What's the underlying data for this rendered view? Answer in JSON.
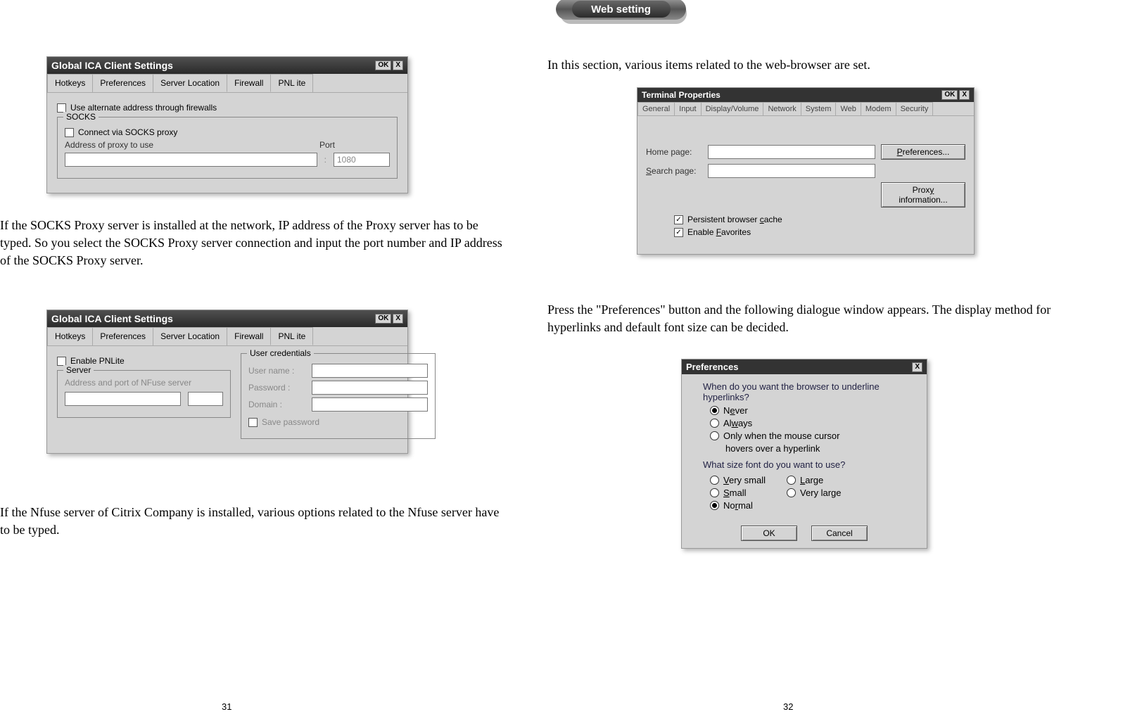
{
  "left": {
    "ica": {
      "title": "Global ICA Client Settings",
      "ok": "OK",
      "close": "X",
      "tabs": [
        "Hotkeys",
        "Preferences",
        "Server Location",
        "Firewall",
        "PNL ite"
      ],
      "firewall": {
        "alt_addr": "Use alternate address through firewalls",
        "socks_legend": "SOCKS",
        "connect_via": "Connect via SOCKS proxy",
        "proxy_label": "Address of proxy to use",
        "port_label": "Port",
        "port_value": "1080"
      },
      "pnlite": {
        "enable": "Enable PNLite",
        "server_legend": "Server",
        "server_label": "Address and port of NFuse server",
        "uc_legend": "User credentials",
        "user_label": "User name :",
        "pass_label": "Password :",
        "domain_label": "Domain :",
        "save_pw": "Save password"
      }
    },
    "para1": "If the SOCKS Proxy server is installed at the network, IP address of the Proxy server has to be typed. So you select the SOCKS Proxy server connection and input the port number and IP address of the SOCKS Proxy server.",
    "para2": "If the Nfuse server of Citrix Company is installed, various options related to the Nfuse server have to be typed.",
    "pagenum": "31"
  },
  "right": {
    "header": "Web setting",
    "para1": "In this section, various items related to the web-browser are set.",
    "term": {
      "title": "Terminal Properties",
      "ok": "OK",
      "close": "X",
      "tabs": [
        "General",
        "Input",
        "Display/Volume",
        "Network",
        "System",
        "Web",
        "Modem",
        "Security"
      ],
      "home_label": "Home page:",
      "search_label": "Search page:",
      "prefs_btn": "Preferences...",
      "proxy_btn": "Proxy information...",
      "cache_chk": "Persistent browser cache",
      "fav_chk": "Enable Favorites"
    },
    "para2": "Press the \"Preferences\" button and the following dialogue window appears. The display method for hyperlinks and default font size can be decided.",
    "pref": {
      "title": "Preferences",
      "close": "X",
      "q1": "When do you want the browser to underline hyperlinks?",
      "r1": "Never",
      "r2": "Always",
      "r3": "Only when the mouse cursor",
      "r3b": "hovers over a hyperlink",
      "q2": "What size font do you want to use?",
      "f1": "Very small",
      "f2": "Small",
      "f3": "Normal",
      "f4": "Large",
      "f5": "Very large",
      "ok": "OK",
      "cancel": "Cancel"
    },
    "pagenum": "32"
  }
}
